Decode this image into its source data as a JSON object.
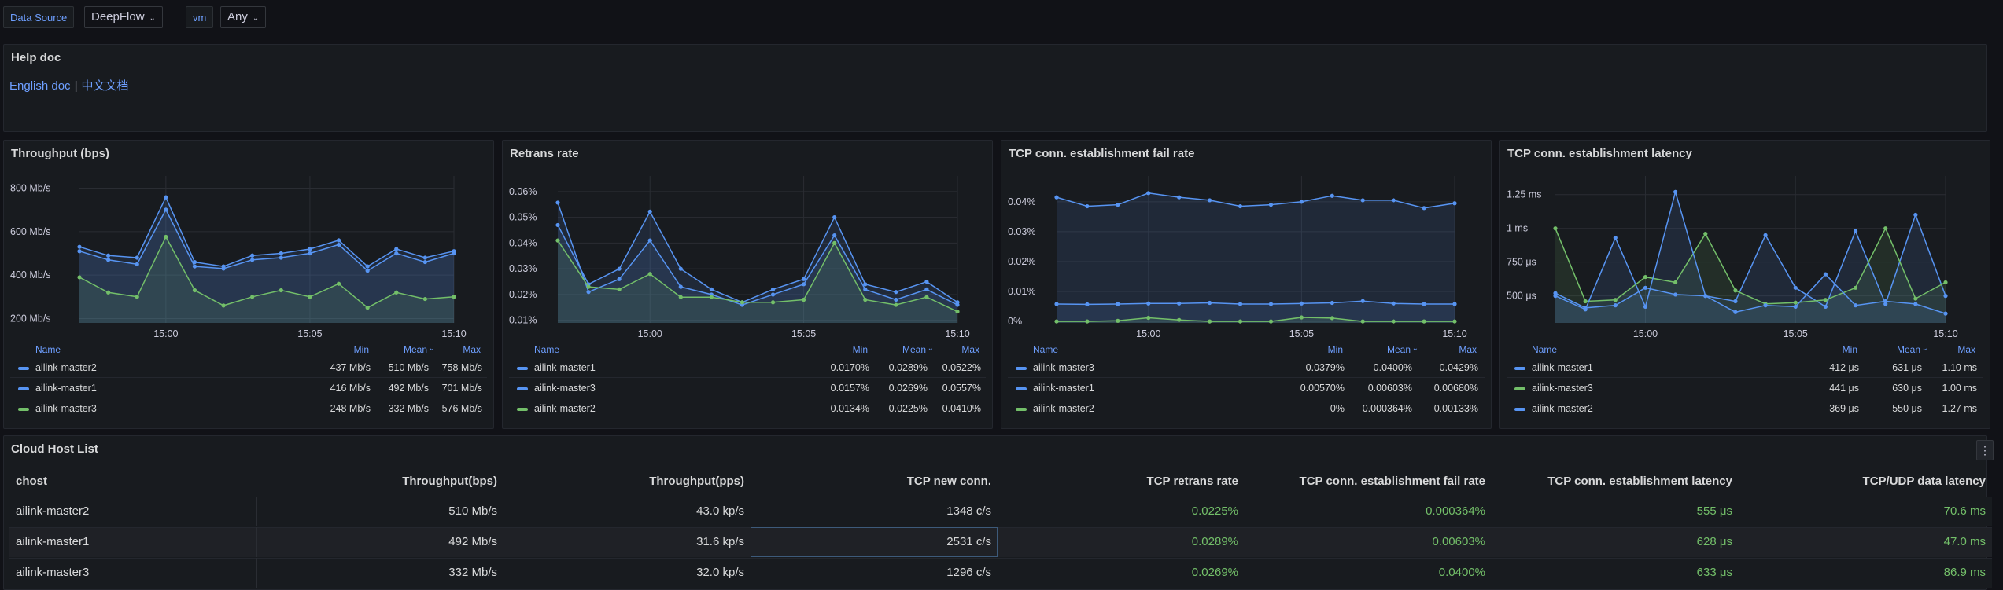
{
  "variables": [
    {
      "label": "Data Source",
      "value": "DeepFlow"
    },
    {
      "label": "vm",
      "value": "Any"
    }
  ],
  "help": {
    "title": "Help doc",
    "link_en": "English doc",
    "separator": "|",
    "link_cn": "中文文档"
  },
  "colors": {
    "blue": "#5794f2",
    "green": "#73bf69",
    "bg": "#111217",
    "panel": "#181b1f",
    "link": "#6e9fff"
  },
  "legend_headers": {
    "name": "Name",
    "min": "Min",
    "mean": "Mean",
    "max": "Max"
  },
  "panels": [
    {
      "title": "Throughput (bps)",
      "legend": [
        {
          "name": "ailink-master2",
          "color": "blue",
          "min": "437 Mb/s",
          "mean": "510 Mb/s",
          "max": "758 Mb/s"
        },
        {
          "name": "ailink-master1",
          "color": "blue",
          "min": "416 Mb/s",
          "mean": "492 Mb/s",
          "max": "701 Mb/s"
        },
        {
          "name": "ailink-master3",
          "color": "green",
          "min": "248 Mb/s",
          "mean": "332 Mb/s",
          "max": "576 Mb/s"
        }
      ]
    },
    {
      "title": "Retrans rate",
      "legend": [
        {
          "name": "ailink-master1",
          "color": "blue",
          "min": "0.0170%",
          "mean": "0.0289%",
          "max": "0.0522%"
        },
        {
          "name": "ailink-master3",
          "color": "blue",
          "min": "0.0157%",
          "mean": "0.0269%",
          "max": "0.0557%"
        },
        {
          "name": "ailink-master2",
          "color": "green",
          "min": "0.0134%",
          "mean": "0.0225%",
          "max": "0.0410%"
        }
      ]
    },
    {
      "title": "TCP conn. establishment fail rate",
      "legend": [
        {
          "name": "ailink-master3",
          "color": "blue",
          "min": "0.0379%",
          "mean": "0.0400%",
          "max": "0.0429%"
        },
        {
          "name": "ailink-master1",
          "color": "blue",
          "min": "0.00570%",
          "mean": "0.00603%",
          "max": "0.00680%"
        },
        {
          "name": "ailink-master2",
          "color": "green",
          "min": "0%",
          "mean": "0.000364%",
          "max": "0.00133%"
        }
      ]
    },
    {
      "title": "TCP conn. establishment latency",
      "legend": [
        {
          "name": "ailink-master1",
          "color": "blue",
          "min": "412 μs",
          "mean": "631 μs",
          "max": "1.10 ms"
        },
        {
          "name": "ailink-master3",
          "color": "green",
          "min": "441 μs",
          "mean": "630 μs",
          "max": "1.00 ms"
        },
        {
          "name": "ailink-master2",
          "color": "blue",
          "min": "369 μs",
          "mean": "550 μs",
          "max": "1.27 ms"
        }
      ]
    }
  ],
  "chart_data": [
    {
      "type": "line",
      "title": "Throughput (bps)",
      "x_ticks": [
        "15:00",
        "15:05",
        "15:10"
      ],
      "y_ticks": [
        "200 Mb/s",
        "400 Mb/s",
        "600 Mb/s",
        "800 Mb/s"
      ],
      "ylim": [
        180,
        820
      ],
      "x": [
        "14:57:30",
        "14:58:30",
        "14:59:30",
        "15:00",
        "15:01",
        "15:02",
        "15:03",
        "15:04",
        "15:05",
        "15:06",
        "15:07",
        "15:08",
        "15:09",
        "15:10"
      ],
      "series": [
        {
          "name": "ailink-master2",
          "color": "#5794f2",
          "values": [
            530,
            490,
            480,
            758,
            460,
            440,
            490,
            500,
            520,
            560,
            440,
            520,
            480,
            510
          ]
        },
        {
          "name": "ailink-master1",
          "color": "#5794f2",
          "values": [
            510,
            470,
            450,
            701,
            440,
            430,
            470,
            480,
            500,
            540,
            420,
            500,
            460,
            500
          ]
        },
        {
          "name": "ailink-master3",
          "color": "#73bf69",
          "values": [
            390,
            320,
            300,
            576,
            330,
            260,
            300,
            330,
            300,
            360,
            250,
            320,
            290,
            300
          ]
        }
      ]
    },
    {
      "type": "line",
      "title": "Retrans rate",
      "x_ticks": [
        "15:00",
        "15:05",
        "15:10"
      ],
      "y_ticks": [
        "0.01%",
        "0.02%",
        "0.03%",
        "0.04%",
        "0.05%",
        "0.06%"
      ],
      "ylim": [
        0.009,
        0.063
      ],
      "x": [
        "14:57:30",
        "14:58:30",
        "14:59:30",
        "15:00",
        "15:01",
        "15:02",
        "15:03",
        "15:04",
        "15:05",
        "15:06",
        "15:07",
        "15:08",
        "15:09",
        "15:10"
      ],
      "series": [
        {
          "name": "ailink-master1",
          "color": "#5794f2",
          "values": [
            0.047,
            0.024,
            0.03,
            0.0522,
            0.03,
            0.022,
            0.017,
            0.022,
            0.026,
            0.05,
            0.024,
            0.021,
            0.025,
            0.017
          ]
        },
        {
          "name": "ailink-master3",
          "color": "#5794f2",
          "values": [
            0.0557,
            0.021,
            0.026,
            0.041,
            0.023,
            0.02,
            0.016,
            0.02,
            0.024,
            0.043,
            0.022,
            0.018,
            0.022,
            0.016
          ]
        },
        {
          "name": "ailink-master2",
          "color": "#73bf69",
          "values": [
            0.041,
            0.023,
            0.022,
            0.028,
            0.019,
            0.019,
            0.017,
            0.017,
            0.018,
            0.04,
            0.018,
            0.016,
            0.019,
            0.0134
          ]
        }
      ]
    },
    {
      "type": "line",
      "title": "TCP conn. establishment fail rate",
      "x_ticks": [
        "15:00",
        "15:05",
        "15:10"
      ],
      "y_ticks": [
        "0%",
        "0.01%",
        "0.02%",
        "0.03%",
        "0.04%"
      ],
      "ylim": [
        -0.0005,
        0.046
      ],
      "x": [
        "14:57:30",
        "14:58:30",
        "14:59:30",
        "15:00",
        "15:01",
        "15:02",
        "15:03",
        "15:04",
        "15:05",
        "15:06",
        "15:07",
        "15:08",
        "15:09",
        "15:10"
      ],
      "series": [
        {
          "name": "ailink-master3",
          "color": "#5794f2",
          "values": [
            0.0415,
            0.0385,
            0.039,
            0.0429,
            0.0415,
            0.0405,
            0.0385,
            0.039,
            0.04,
            0.042,
            0.0405,
            0.0405,
            0.0379,
            0.0395
          ]
        },
        {
          "name": "ailink-master1",
          "color": "#5794f2",
          "values": [
            0.0058,
            0.0057,
            0.0058,
            0.006,
            0.006,
            0.0062,
            0.0058,
            0.0058,
            0.006,
            0.0062,
            0.0068,
            0.006,
            0.0058,
            0.0058
          ]
        },
        {
          "name": "ailink-master2",
          "color": "#73bf69",
          "values": [
            0,
            0,
            0.0002,
            0.0012,
            0.0005,
            0,
            0,
            0,
            0.00133,
            0.0011,
            0,
            0,
            0,
            0
          ]
        }
      ]
    },
    {
      "type": "line",
      "title": "TCP conn. establishment latency",
      "x_ticks": [
        "15:00",
        "15:05",
        "15:10"
      ],
      "y_ticks": [
        "500 μs",
        "750 μs",
        "1 ms",
        "1.25 ms"
      ],
      "ylim": [
        300,
        1330
      ],
      "x": [
        "14:57:30",
        "14:58:30",
        "14:59:30",
        "15:00",
        "15:01",
        "15:02",
        "15:03",
        "15:04",
        "15:05",
        "15:06",
        "15:07",
        "15:08",
        "15:09",
        "15:10"
      ],
      "series": [
        {
          "name": "ailink-master1",
          "color": "#5794f2",
          "values": [
            520,
            412,
            430,
            560,
            510,
            500,
            460,
            950,
            560,
            420,
            980,
            440,
            1100,
            500
          ]
        },
        {
          "name": "ailink-master3",
          "color": "#73bf69",
          "values": [
            1000,
            460,
            470,
            640,
            600,
            960,
            540,
            441,
            450,
            470,
            560,
            1000,
            480,
            600
          ]
        },
        {
          "name": "ailink-master2",
          "color": "#5794f2",
          "values": [
            500,
            400,
            930,
            420,
            1270,
            500,
            380,
            430,
            420,
            660,
            430,
            460,
            440,
            369
          ]
        }
      ]
    }
  ],
  "host_list": {
    "title": "Cloud Host List",
    "menu_icon": "⋮",
    "columns": [
      "chost",
      "Throughput(bps)",
      "Throughput(pps)",
      "TCP new conn.",
      "TCP retrans rate",
      "TCP conn. establishment fail rate",
      "TCP conn. establishment latency",
      "TCP/UDP data latency"
    ],
    "rows": [
      [
        "ailink-master2",
        "510 Mb/s",
        "43.0 kp/s",
        "1348 c/s",
        "0.0225%",
        "0.000364%",
        "555 μs",
        "70.6 ms"
      ],
      [
        "ailink-master1",
        "492 Mb/s",
        "31.6 kp/s",
        "2531 c/s",
        "0.0289%",
        "0.00603%",
        "628 μs",
        "47.0 ms"
      ],
      [
        "ailink-master3",
        "332 Mb/s",
        "32.0 kp/s",
        "1296 c/s",
        "0.0269%",
        "0.0400%",
        "633 μs",
        "86.9 ms"
      ]
    ]
  }
}
